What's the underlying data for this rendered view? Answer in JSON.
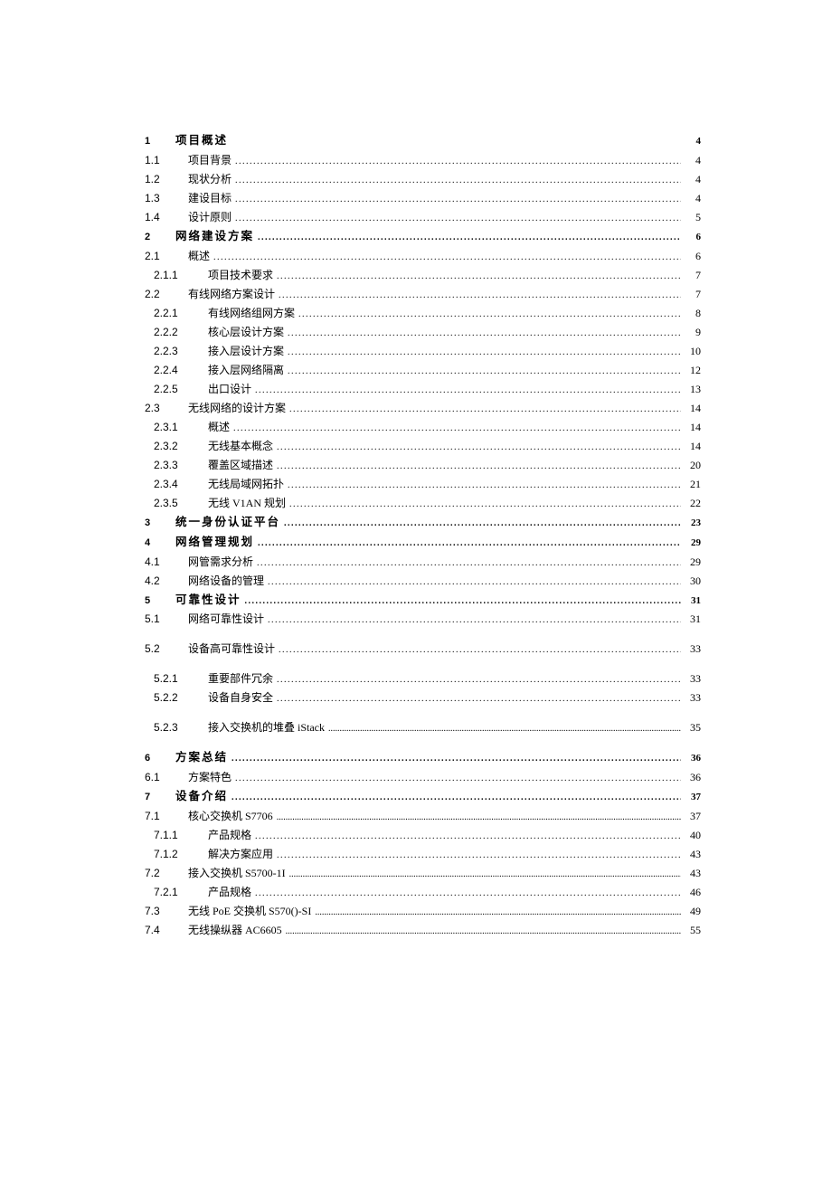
{
  "toc": [
    {
      "level": 1,
      "num": "1",
      "title": "项目概述",
      "page": "4",
      "leader": "none"
    },
    {
      "level": 2,
      "num": "1.1",
      "title": "项目背景",
      "page": "4",
      "leader": "dots"
    },
    {
      "level": 2,
      "num": "1.2",
      "title": "现状分析",
      "page": "4",
      "leader": "dots"
    },
    {
      "level": 2,
      "num": "1.3",
      "title": "建设目标",
      "page": "4",
      "leader": "dots"
    },
    {
      "level": 2,
      "num": "1.4",
      "title": "设计原则",
      "page": "5",
      "leader": "dots"
    },
    {
      "level": 1,
      "num": "2",
      "title": "网络建设方案",
      "page": "6",
      "leader": "dots"
    },
    {
      "level": 2,
      "num": "2.1",
      "title": "概述",
      "page": "6",
      "leader": "dots"
    },
    {
      "level": 3,
      "num": "2.1.1",
      "title": "项目技术要求",
      "page": "7",
      "leader": "dots"
    },
    {
      "level": 2,
      "num": "2.2",
      "title": "有线网络方案设计",
      "page": "7",
      "leader": "dots"
    },
    {
      "level": 3,
      "num": "2.2.1",
      "title": "有线网络组网方案",
      "page": "8",
      "leader": "dots"
    },
    {
      "level": 3,
      "num": "2.2.2",
      "title": "核心层设计方案",
      "page": "9",
      "leader": "dots"
    },
    {
      "level": 3,
      "num": "2.2.3",
      "title": "接入层设计方案",
      "page": "10",
      "leader": "dots"
    },
    {
      "level": 3,
      "num": "2.2.4",
      "title": "接入层网络隔离",
      "page": "12",
      "leader": "dots"
    },
    {
      "level": 3,
      "num": "2.2.5",
      "title": "出口设计",
      "page": "13",
      "leader": "dots"
    },
    {
      "level": 2,
      "num": "2.3",
      "title": "无线网络的设计方案",
      "page": "14",
      "leader": "dots"
    },
    {
      "level": 3,
      "num": "2.3.1",
      "title": "概述",
      "page": "14",
      "leader": "dots"
    },
    {
      "level": 3,
      "num": "2.3.2",
      "title": "无线基本概念",
      "page": "14",
      "leader": "dots"
    },
    {
      "level": 3,
      "num": "2.3.3",
      "title": "覆盖区域描述",
      "page": "20",
      "leader": "dots"
    },
    {
      "level": 3,
      "num": "2.3.4",
      "title": "无线局域网拓扑",
      "page": "21",
      "leader": "dots"
    },
    {
      "level": 3,
      "num": "2.3.5",
      "title": "无线 V1AN 规划",
      "page": "22",
      "leader": "dots"
    },
    {
      "level": 1,
      "num": "3",
      "title": "统一身份认证平台",
      "page": "23",
      "leader": "dots"
    },
    {
      "level": 1,
      "num": "4",
      "title": "网络管理规划",
      "page": "29",
      "leader": "dots"
    },
    {
      "level": 2,
      "num": "4.1",
      "title": "网管需求分析",
      "page": "29",
      "leader": "dots"
    },
    {
      "level": 2,
      "num": "4.2",
      "title": "网络设备的管理",
      "page": "30",
      "leader": "dots"
    },
    {
      "level": 1,
      "num": "5",
      "title": "可靠性设计",
      "page": "31",
      "leader": "dots"
    },
    {
      "level": 2,
      "num": "5.1",
      "title": "网络可靠性设计",
      "page": "31",
      "leader": "dots"
    },
    {
      "level": 2,
      "num": "5.2",
      "title": "设备高可靠性设计",
      "page": "33",
      "leader": "dots",
      "gapBefore": true
    },
    {
      "level": 3,
      "num": "5.2.1",
      "title": "重要部件冗余",
      "page": "33",
      "leader": "dots",
      "gapBefore": true
    },
    {
      "level": 3,
      "num": "5.2.2",
      "title": "设备自身安全",
      "page": "33",
      "leader": "dots"
    },
    {
      "level": 3,
      "num": "5.2.3",
      "title": "接入交换机的堆叠 iStack",
      "page": "35",
      "leader": "dense",
      "gapBefore": true
    },
    {
      "level": 1,
      "num": "6",
      "title": "方案总结",
      "page": "36",
      "leader": "dots",
      "gapBefore": true
    },
    {
      "level": 2,
      "num": "6.1",
      "title": "方案特色",
      "page": "36",
      "leader": "dots"
    },
    {
      "level": 1,
      "num": "7",
      "title": "设备介绍",
      "page": "37",
      "leader": "dots"
    },
    {
      "level": 2,
      "num": "7.1",
      "title": "核心交换机 S7706",
      "page": "37",
      "leader": "dense"
    },
    {
      "level": 3,
      "num": "7.1.1",
      "title": "产品规格",
      "page": "40",
      "leader": "dots"
    },
    {
      "level": 3,
      "num": "7.1.2",
      "title": "解决方案应用",
      "page": "43",
      "leader": "dots"
    },
    {
      "level": 2,
      "num": "7.2",
      "title": "接入交换机 S5700-1I",
      "page": "43",
      "leader": "dense"
    },
    {
      "level": 3,
      "num": "7.2.1",
      "title": "产品规格",
      "page": "46",
      "leader": "dots"
    },
    {
      "level": 2,
      "num": "7.3",
      "title": "无线 PoE 交换机 S570()-SI",
      "page": "49",
      "leader": "dense"
    },
    {
      "level": 2,
      "num": "7.4",
      "title": "无线操纵器 AC6605",
      "page": "55",
      "leader": "dense"
    }
  ]
}
